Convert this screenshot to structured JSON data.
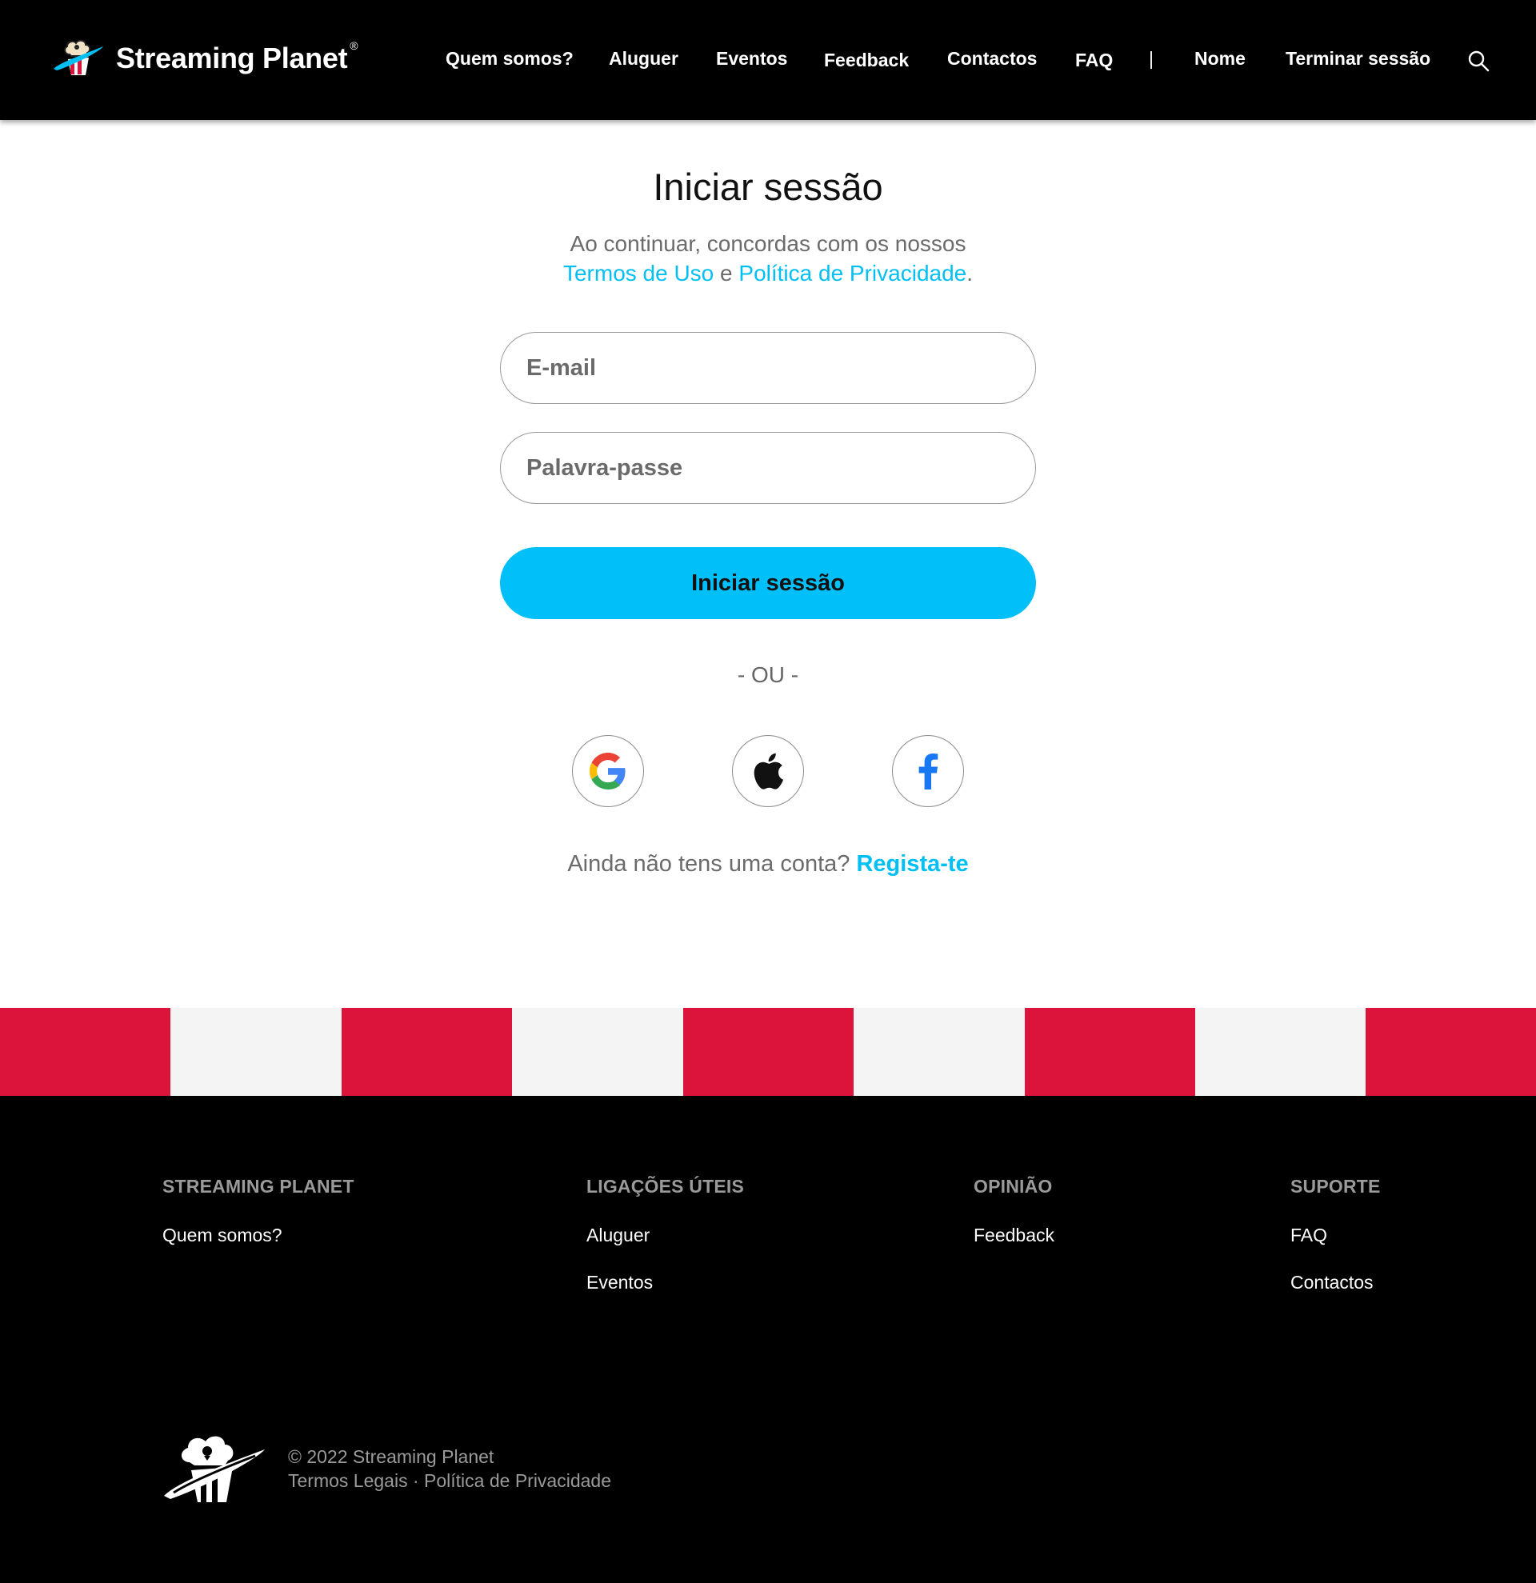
{
  "header": {
    "brand_name": "Streaming Planet",
    "brand_mark": "®",
    "logo_icon": "popcorn-planet-logo",
    "nav": [
      {
        "id": "quem-somos",
        "label": "Quem somos?"
      },
      {
        "id": "aluguer",
        "label": "Aluguer"
      },
      {
        "id": "eventos",
        "label": "Eventos"
      },
      {
        "id": "feedback",
        "label": "Feedback"
      },
      {
        "id": "contactos",
        "label": "Contactos"
      },
      {
        "id": "faq",
        "label": "FAQ"
      }
    ],
    "separator": "|",
    "user_name": "Nome",
    "logout_label": "Terminar sessão",
    "search_icon": "search-icon"
  },
  "login": {
    "title": "Iniciar sessão",
    "terms_prefix": "Ao continuar, concordas com os nossos",
    "terms_link": "Termos de Uso",
    "terms_and": "e",
    "privacy_link": "Política de Privacidade",
    "terms_end": ".",
    "email_placeholder": "E-mail",
    "password_placeholder": "Palavra-passe",
    "submit_label": "Iniciar sessão",
    "or_label": "- OU -",
    "social": [
      "google-icon",
      "apple-icon",
      "facebook-icon"
    ],
    "signup_prompt": "Ainda não tens uma conta?",
    "signup_link": "Regista-te"
  },
  "colors": {
    "accent": "#00bff3",
    "stripe_red": "#dc143c",
    "stripe_light": "#f4f4f4",
    "header_bg": "#000000"
  },
  "footer": {
    "columns": [
      {
        "heading": "STREAMING PLANET",
        "links": [
          "Quem somos?"
        ]
      },
      {
        "heading": "LIGAÇÕES ÚTEIS",
        "links": [
          "Aluguer",
          "Eventos"
        ]
      },
      {
        "heading": "OPINIÃO",
        "links": [
          "Feedback"
        ]
      },
      {
        "heading": "SUPORTE",
        "links": [
          "FAQ",
          "Contactos"
        ]
      }
    ],
    "copyright": "© 2022 Streaming Planet",
    "legal_link": "Termos Legais",
    "dot": "·",
    "privacy_link": "Política de Privacidade"
  }
}
